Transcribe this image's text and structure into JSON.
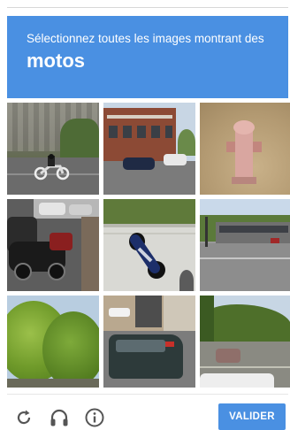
{
  "header": {
    "instruction": "Sélectionnez toutes les images montrant des",
    "target": "motos"
  },
  "grid": {
    "tiles": [
      {
        "scene": "street with wall and motorcycle rider"
      },
      {
        "scene": "brick building with parked cars"
      },
      {
        "scene": "fire hydrant"
      },
      {
        "scene": "parked motorcycles and scooters on street"
      },
      {
        "scene": "parked motorcycle aerial view"
      },
      {
        "scene": "road with building"
      },
      {
        "scene": "green trees"
      },
      {
        "scene": "parked van and cars"
      },
      {
        "scene": "trees and road with cars"
      }
    ]
  },
  "footer": {
    "reload_icon": "reload-icon",
    "audio_icon": "headphones-icon",
    "info_icon": "info-icon",
    "verify_label": "VALIDER"
  },
  "colors": {
    "accent": "#4a90e2",
    "icon": "#555555"
  }
}
